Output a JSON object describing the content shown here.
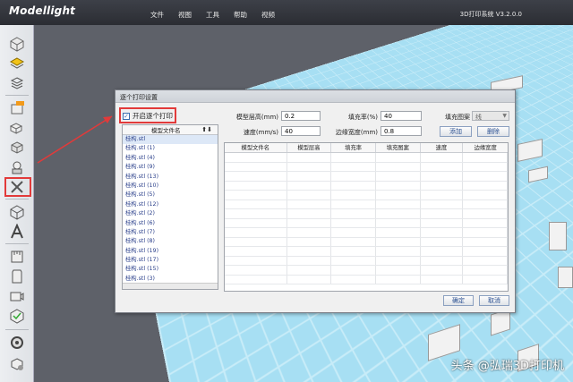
{
  "app": {
    "logo": "Modellight",
    "title": "3D打印系统 V3.2.0.0"
  },
  "menu": [
    "文件",
    "视图",
    "工具",
    "帮助",
    "视频"
  ],
  "toolbar": {
    "icons": [
      "cube-icon",
      "layers-icon",
      "cube-stack-icon",
      "badge-box-icon",
      "cube-multi-icon",
      "cube-open-icon",
      "sequential-print-icon",
      "tools-icon",
      "cube-wire-icon",
      "text-a-icon",
      "ruler-icon",
      "sd-card-icon",
      "camera-icon",
      "cube-check-icon",
      "gear-icon",
      "cube-person-icon"
    ]
  },
  "dialog": {
    "title": "逐个打印设置",
    "enable_label": "开启逐个打印",
    "enable_checked": true,
    "filelist_header": "模型文件名",
    "files": [
      "桂构.stl",
      "桂构.stl (1)",
      "桂构.stl (4)",
      "桂构.stl (9)",
      "桂构.stl (13)",
      "桂构.stl (10)",
      "桂构.stl (5)",
      "桂构.stl (12)",
      "桂构.stl (2)",
      "桂构.stl (6)",
      "桂构.stl (7)",
      "桂构.stl (8)",
      "桂构.stl (19)",
      "桂构.stl (17)",
      "桂构.stl (15)",
      "桂构.stl (3)"
    ],
    "layer_height_label": "模型层高(mm)",
    "layer_height_value": "0.2",
    "infill_label": "填充率(%)",
    "infill_value": "40",
    "pattern_label": "填充图案",
    "pattern_value": "线",
    "speed_label": "速度(mm/s)",
    "speed_value": "40",
    "edge_label": "边缘宽度(mm)",
    "edge_value": "0.8",
    "add_label": "添加",
    "delete_label": "删除",
    "columns": [
      "模型文件名",
      "模型层高",
      "填充率",
      "填充图案",
      "速度",
      "边缘宽度"
    ],
    "ok_label": "确定",
    "cancel_label": "取消"
  },
  "watermark": "头条 @弘瑞3D打印机",
  "colors": {
    "highlight": "#e23a3a",
    "bed": "#a7dff3",
    "titlebar": "#2b2d33"
  }
}
